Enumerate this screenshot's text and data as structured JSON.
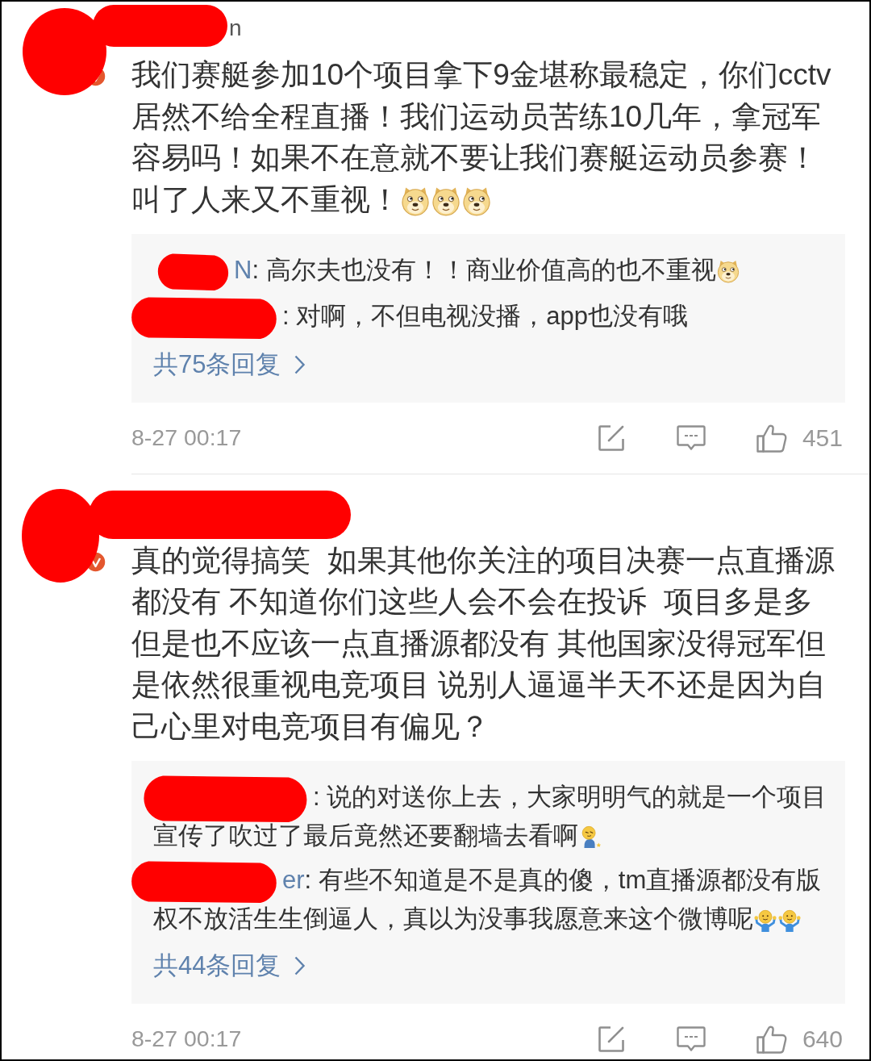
{
  "comments": [
    {
      "author": {
        "name_tail": "n",
        "scribble": {
          "kind": "short"
        },
        "verified": true
      },
      "text": "我们赛艇参加10个项目拿下9金堪称最稳定，你们cctv居然不给全程直播！我们运动员苦练10几年，拿冠军容易吗！如果不在意就不要让我们赛艇运动员参赛！叫了人来又不重视！",
      "emojis": [
        {
          "kind": "doge"
        },
        {
          "kind": "doge"
        },
        {
          "kind": "doge"
        }
      ],
      "replies": [
        {
          "scribble": {
            "kind": "short"
          },
          "name_tail": "N",
          "text": ": 高尔夫也没有！！商业价值高的也不重视",
          "emojis": [
            {
              "kind": "doge"
            }
          ]
        },
        {
          "scribble": {
            "kind": "medium"
          },
          "text": ": 对啊，不但电视没播，app也没有哦"
        }
      ],
      "more_replies": "共75条回复",
      "time": "8-27 00:17",
      "likes": "451"
    },
    {
      "author": {
        "scribble": {
          "kind": "long"
        },
        "verified": true
      },
      "text": "真的觉得搞笑  如果其他你关注的项目决赛一点直播源都没有 不知道你们这些人会不会在投诉  项目多是多但是也不应该一点直播源都没有 其他国家没得冠军但是依然很重视电竞项目 说别人逼逼半天不还是因为自己心里对电竞项目有偏见？",
      "replies": [
        {
          "scribble": {
            "kind": "long"
          },
          "text": ": 说的对送你上去，大家明明气的就是一个项目宣传了吹过了最后竟然还要翻墙去看啊",
          "emojis": [
            {
              "kind": "kneeling"
            }
          ]
        },
        {
          "scribble": {
            "kind": "medium"
          },
          "name_tail": "er",
          "text": ": 有些不知道是不是真的傻，tm直播源都没有版权不放活生生倒逼人，真以为没事我愿意来这个微博呢",
          "emojis": [
            {
              "kind": "shrug"
            },
            {
              "kind": "shrug"
            }
          ]
        }
      ],
      "more_replies": "共44条回复",
      "time": "8-27 00:17",
      "likes": "640"
    }
  ]
}
